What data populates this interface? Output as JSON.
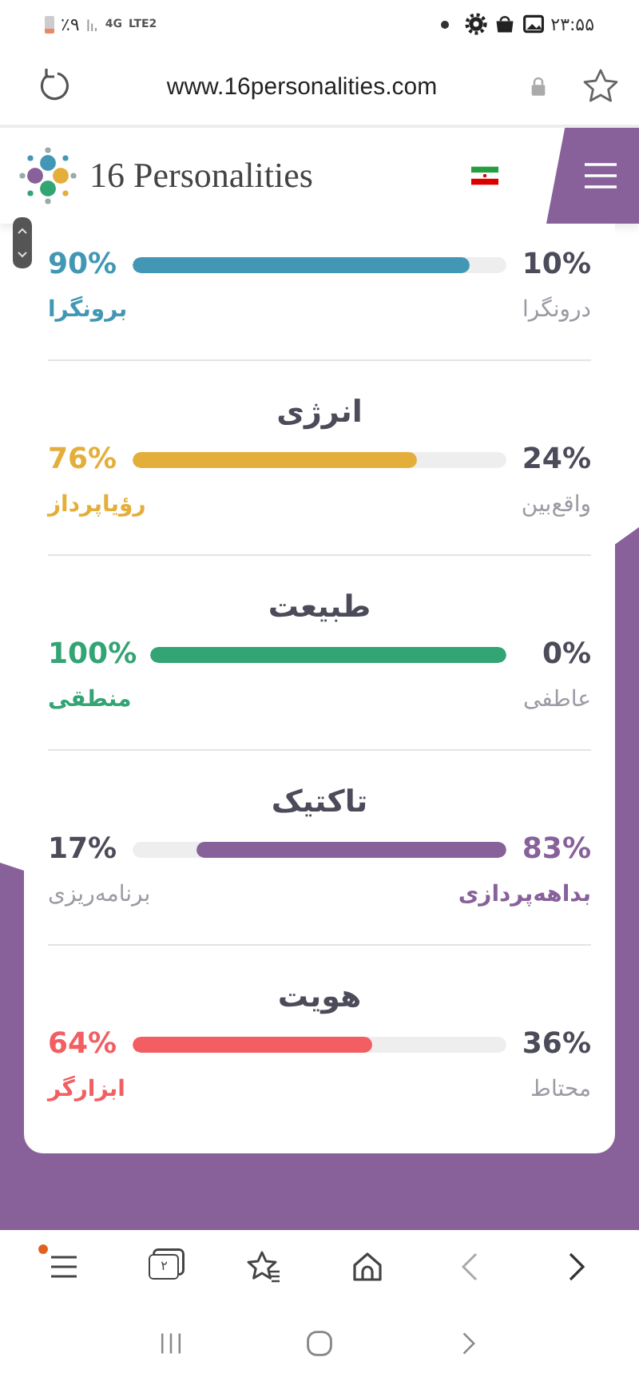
{
  "status_bar": {
    "battery": "٪۹",
    "network": "4G",
    "network_sub": "LTE2",
    "time": "۲۳:۵۵"
  },
  "browser": {
    "url": "www.16personalities.com",
    "tab_count": "۲"
  },
  "site_header": {
    "logo": "16 Personalities"
  },
  "traits": [
    {
      "left_pct": "90%",
      "left_label": "برونگرا",
      "right_pct": "10%",
      "right_label": "درونگرا",
      "fill_from_right": false,
      "level": 0.9,
      "color": "#4298b4"
    },
    {
      "title": "انرژی",
      "left_pct": "76%",
      "left_label": "رؤیاپرداز",
      "right_pct": "24%",
      "right_label": "واقع‌بین",
      "fill_from_right": false,
      "level": 0.76,
      "color": "#e4ae3a"
    },
    {
      "title": "طبیعت",
      "left_pct": "100%",
      "left_label": "منطقی",
      "right_pct": "0%",
      "right_label": "عاطفی",
      "fill_from_right": false,
      "level": 1,
      "color": "#33a474"
    },
    {
      "title": "تاکتیک",
      "left_pct": "17%",
      "left_label": "برنامه‌ریزی",
      "right_pct": "83%",
      "right_label": "بداهه‌پردازی",
      "fill_from_right": true,
      "level": 0.83,
      "color": "#88619a"
    },
    {
      "title": "هویت",
      "left_pct": "64%",
      "left_label": "ابزارگر",
      "right_pct": "36%",
      "right_label": "محتاط",
      "fill_from_right": false,
      "level": 0.64,
      "color": "#f25e62"
    }
  ]
}
